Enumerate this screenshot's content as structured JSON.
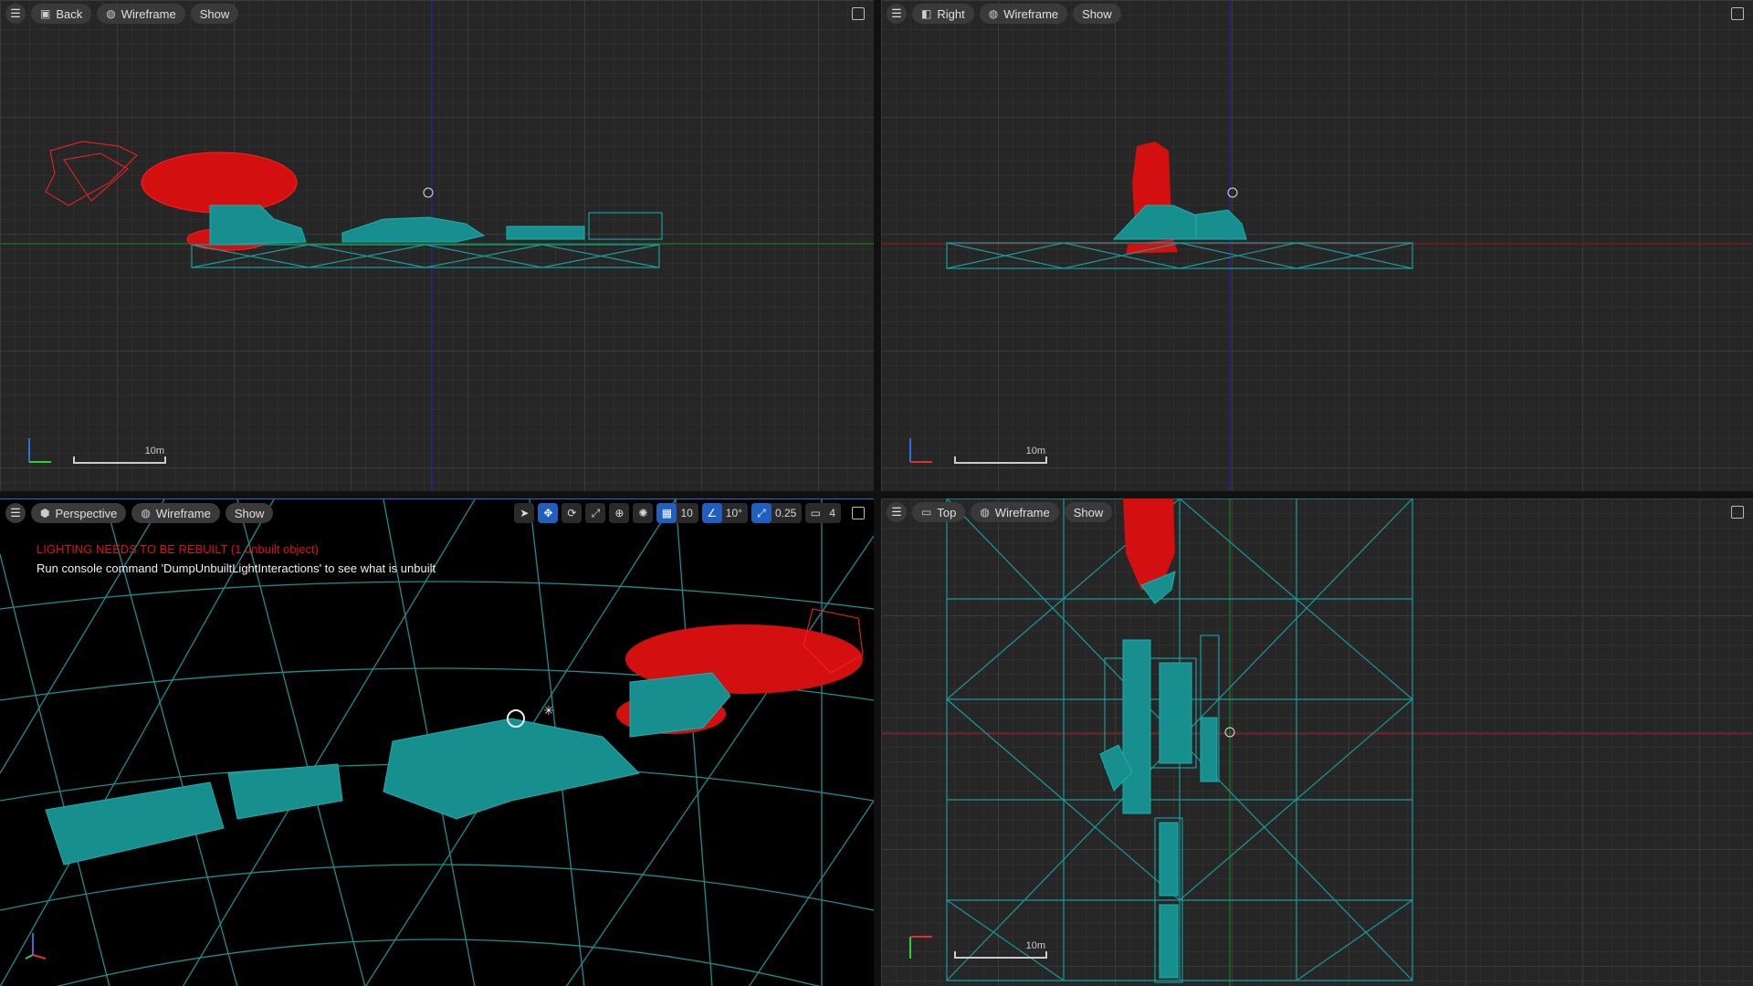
{
  "viewports": {
    "back": {
      "view_label": "Back",
      "mode_label": "Wireframe",
      "show_label": "Show",
      "scale_label": "10m"
    },
    "right": {
      "view_label": "Right",
      "mode_label": "Wireframe",
      "show_label": "Show",
      "scale_label": "10m"
    },
    "perspective": {
      "view_label": "Perspective",
      "mode_label": "Wireframe",
      "show_label": "Show",
      "lighting_warning": "LIGHTING NEEDS TO BE REBUILT (1 unbuilt object)",
      "console_hint": "Run console command 'DumpUnbuiltLightInteractions' to see what is unbuilt",
      "grid_snap_value": "10",
      "rotation_snap_value": "10°",
      "scale_snap_value": "0.25",
      "camera_speed_value": "4"
    },
    "top": {
      "view_label": "Top",
      "mode_label": "Wireframe",
      "show_label": "Show",
      "scale_label": "10m"
    }
  },
  "colors": {
    "wire_cyan": "#1a9a9a",
    "wire_red": "#e01010",
    "grid_bg": "#262626",
    "accent_blue": "#1f5fbf"
  },
  "icons": [
    "menu-icon",
    "view-icon",
    "wireframe-icon",
    "select-icon",
    "translate-icon",
    "rotate-icon",
    "scale-icon",
    "world-icon",
    "surface-snap-icon",
    "grid-snap-icon",
    "rotation-snap-icon",
    "scale-snap-icon",
    "camera-speed-icon",
    "maximize-icon"
  ]
}
